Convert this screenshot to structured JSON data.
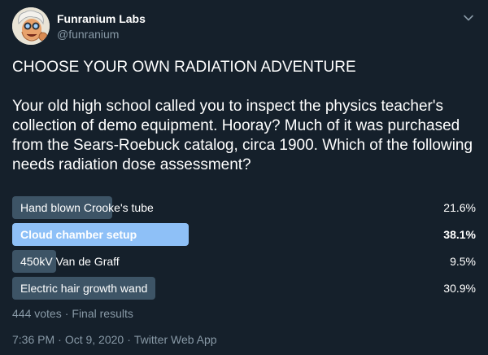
{
  "author": {
    "name": "Funranium Labs",
    "handle": "@funranium"
  },
  "icons": {
    "avatar": "cartoon-scientist-avatar",
    "menu": "chevron-down-icon"
  },
  "tweet": {
    "title": "CHOOSE YOUR OWN RADIATION ADVENTURE",
    "body": "Your old high school called you to inspect the physics teacher's collection of demo equipment. Hooray? Much of it was purchased from the Sears-Roebuck catalog, circa 1900. Which of the following needs radiation dose assessment?"
  },
  "poll": {
    "options": [
      {
        "label": "Hand blown Crooke's tube",
        "percent_text": "21.6%",
        "percent": 21.6,
        "winner": false
      },
      {
        "label": "Cloud chamber setup",
        "percent_text": "38.1%",
        "percent": 38.1,
        "winner": true
      },
      {
        "label": "450kV Van de Graff",
        "percent_text": "9.5%",
        "percent": 9.5,
        "winner": false
      },
      {
        "label": "Electric hair growth wand",
        "percent_text": "30.9%",
        "percent": 30.9,
        "winner": false
      }
    ],
    "votes": "444 votes",
    "status": "Final results"
  },
  "meta": {
    "time": "7:36 PM",
    "date": "Oct 9, 2020",
    "source": "Twitter Web App"
  },
  "colors": {
    "background": "#15202b",
    "bar": "#3d5466",
    "winner_bar": "#8ec0f7",
    "secondary_text": "#8899a6"
  }
}
